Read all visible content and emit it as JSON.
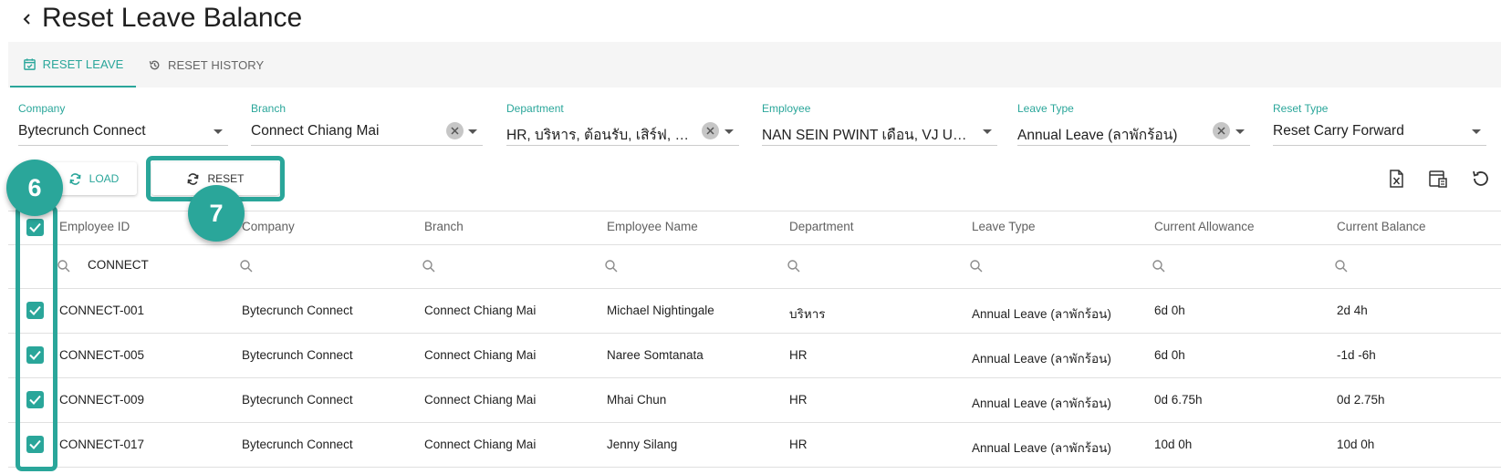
{
  "page": {
    "title": "Reset Leave Balance"
  },
  "tabs": [
    {
      "label": "RESET LEAVE",
      "icon": "calendar-check-icon",
      "active": true
    },
    {
      "label": "RESET HISTORY",
      "icon": "history-icon",
      "active": false
    }
  ],
  "filters": {
    "company": {
      "label": "Company",
      "value": "Bytecrunch Connect"
    },
    "branch": {
      "label": "Branch",
      "value": "Connect Chiang Mai"
    },
    "department": {
      "label": "Department",
      "value": "HR, บริหาร, ต้อนรับ, เสิร์ฟ, บัญชี"
    },
    "employee": {
      "label": "Employee",
      "value": "NAN SEIN PWINT เดือน, VJ UAT..."
    },
    "leave_type": {
      "label": "Leave Type",
      "value": "Annual Leave (ลาพักร้อน)"
    },
    "reset_type": {
      "label": "Reset Type",
      "value": "Reset Carry Forward"
    }
  },
  "actions": {
    "load_label": "LOAD",
    "reset_label": "RESET"
  },
  "toolbar_icons": [
    "excel-export-icon",
    "column-chooser-icon",
    "refresh-icon"
  ],
  "callouts": {
    "step_6": "6",
    "step_7": "7"
  },
  "accent_color": "#2aa69a",
  "table": {
    "columns": [
      "Employee ID",
      "Company",
      "Branch",
      "Employee Name",
      "Department",
      "Leave Type",
      "Current Allowance",
      "Current Balance"
    ],
    "filter_employee_id": "CONNECT",
    "rows": [
      [
        "CONNECT-001",
        "Bytecrunch Connect",
        "Connect Chiang Mai",
        "Michael Nightingale",
        "บริหาร",
        "Annual Leave (ลาพักร้อน)",
        "6d 0h",
        "2d 4h"
      ],
      [
        "CONNECT-005",
        "Bytecrunch Connect",
        "Connect Chiang Mai",
        "Naree Somtanata",
        "HR",
        "Annual Leave (ลาพักร้อน)",
        "6d 0h",
        "-1d -6h"
      ],
      [
        "CONNECT-009",
        "Bytecrunch Connect",
        "Connect Chiang Mai",
        "Mhai Chun",
        "HR",
        "Annual Leave (ลาพักร้อน)",
        "0d 6.75h",
        "0d 2.75h"
      ],
      [
        "CONNECT-017",
        "Bytecrunch Connect",
        "Connect Chiang Mai",
        "Jenny Silang",
        "HR",
        "Annual Leave (ลาพักร้อน)",
        "10d 0h",
        "10d 0h"
      ]
    ]
  }
}
